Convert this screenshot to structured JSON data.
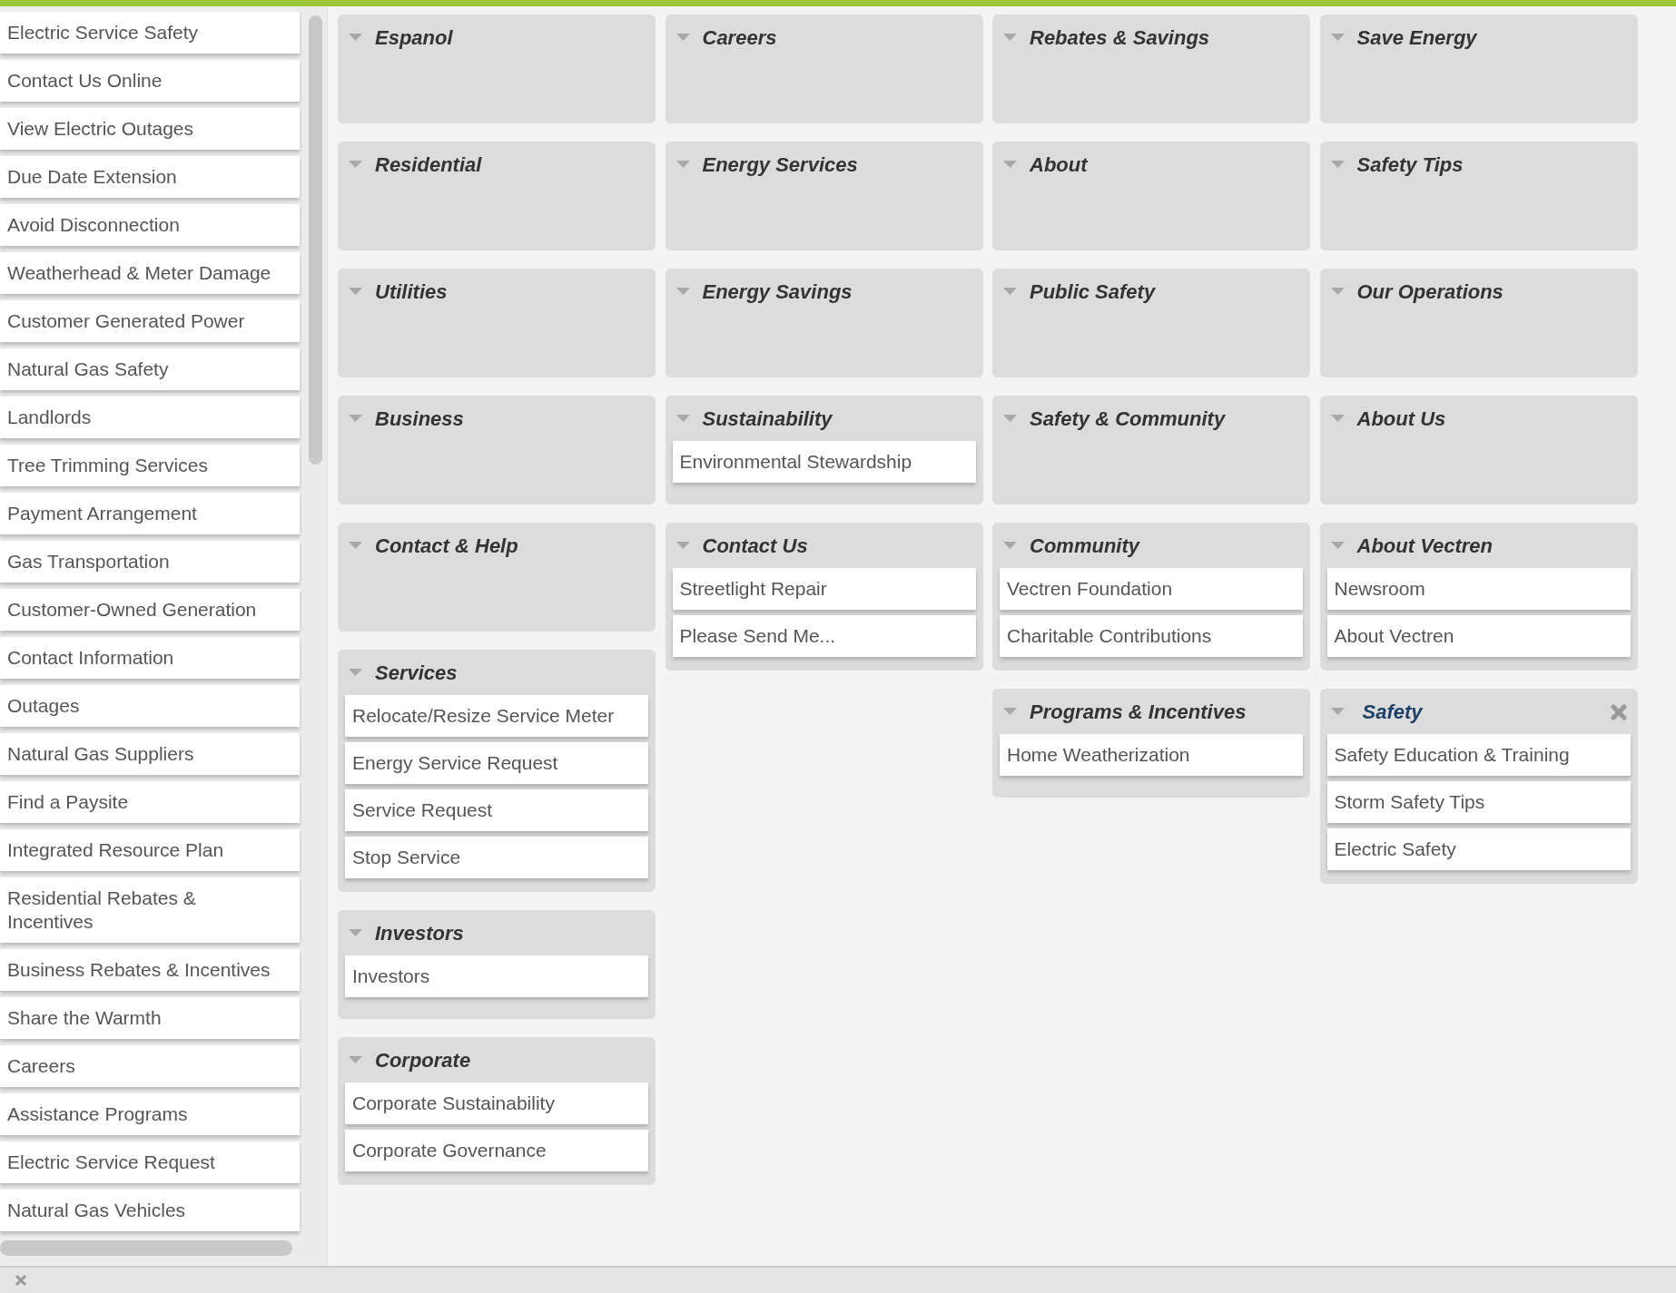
{
  "sidebar": {
    "items": [
      "Electric Service Safety",
      "Contact Us Online",
      "View Electric Outages",
      "Due Date Extension",
      "Avoid Disconnection",
      "Weatherhead & Meter Damage",
      "Customer Generated Power",
      "Natural Gas Safety",
      "Landlords",
      "Tree Trimming Services",
      "Payment Arrangement",
      "Gas Transportation",
      "Customer-Owned Generation",
      "Contact Information",
      "Outages",
      "Natural Gas Suppliers",
      "Find a Paysite",
      "Integrated Resource Plan",
      "Residential Rebates & Incentives",
      "Business Rebates & Incentives",
      "Share the Warmth",
      "Careers",
      "Assistance Programs",
      "Electric Service Request",
      "Natural Gas Vehicles"
    ]
  },
  "columns": [
    {
      "panels": [
        {
          "title": "Espanol",
          "selected": false
        },
        {
          "title": "Residential",
          "selected": false
        },
        {
          "title": "Utilities",
          "selected": false
        },
        {
          "title": "Business",
          "selected": false
        },
        {
          "title": "Contact & Help",
          "selected": false
        },
        {
          "title": "Services",
          "selected": false,
          "items": [
            "Relocate/Resize Service Meter",
            "Energy Service Request",
            "Service Request",
            "Stop Service"
          ]
        },
        {
          "title": "Investors",
          "selected": false,
          "items": [
            "Investors"
          ]
        },
        {
          "title": "Corporate",
          "selected": false,
          "items": [
            "Corporate Sustainability",
            "Corporate Governance"
          ]
        }
      ]
    },
    {
      "panels": [
        {
          "title": "Careers",
          "selected": false
        },
        {
          "title": "Energy Services",
          "selected": false
        },
        {
          "title": "Energy Savings",
          "selected": false
        },
        {
          "title": "Sustainability",
          "selected": false,
          "items": [
            "Environmental Stewardship"
          ]
        },
        {
          "title": "Contact Us",
          "selected": false,
          "items": [
            "Streetlight Repair",
            "Please Send Me..."
          ]
        }
      ]
    },
    {
      "panels": [
        {
          "title": "Rebates & Savings",
          "selected": false
        },
        {
          "title": "About",
          "selected": false
        },
        {
          "title": "Public Safety",
          "selected": false
        },
        {
          "title": "Safety & Community",
          "selected": false
        },
        {
          "title": "Community",
          "selected": false,
          "items": [
            "Vectren Foundation",
            "Charitable Contributions"
          ]
        },
        {
          "title": "Programs & Incentives",
          "selected": false,
          "items": [
            "Home Weatherization"
          ]
        }
      ]
    },
    {
      "panels": [
        {
          "title": "Save Energy",
          "selected": false
        },
        {
          "title": "Safety Tips",
          "selected": false
        },
        {
          "title": "Our Operations",
          "selected": false
        },
        {
          "title": "About Us",
          "selected": false
        },
        {
          "title": "About Vectren",
          "selected": false,
          "items": [
            "Newsroom",
            "About Vectren"
          ]
        },
        {
          "title": "Safety",
          "selected": true,
          "items": [
            "Safety Education & Training",
            "Storm Safety Tips",
            "Electric Safety"
          ]
        }
      ]
    }
  ]
}
